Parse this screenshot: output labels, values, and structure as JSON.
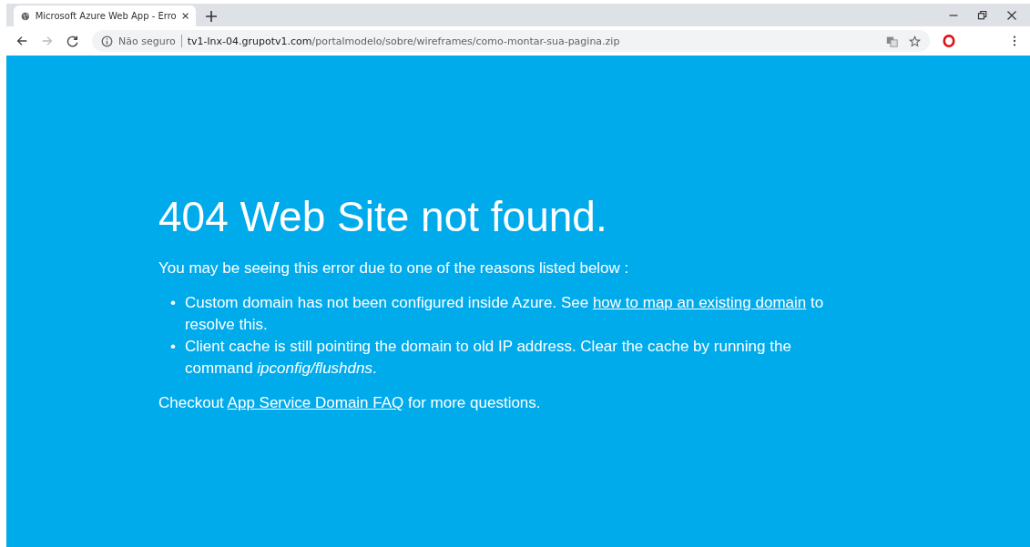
{
  "tab": {
    "title": "Microsoft Azure Web App - Erro"
  },
  "address_bar": {
    "security": "Não seguro",
    "domain": "tv1-lnx-04.grupotv1.com",
    "path": "/portalmodelo/sobre/wireframes/como-montar-sua-pagina.zip"
  },
  "page": {
    "heading": "404 Web Site not found.",
    "intro": "You may be seeing this error due to one of the reasons listed below :",
    "reasons": [
      {
        "bullet": "•",
        "before": "Custom domain has not been configured inside Azure. See ",
        "link": "how to map an existing domain",
        "after": " to resolve this."
      },
      {
        "bullet": "•",
        "before": "Client cache is still pointing the domain to old IP address. Clear the cache by running the command *ipconfig/flushdns*."
      }
    ],
    "footer": {
      "before": "Checkout ",
      "link": "App Service Domain FAQ",
      "after": " for more questions."
    }
  }
}
